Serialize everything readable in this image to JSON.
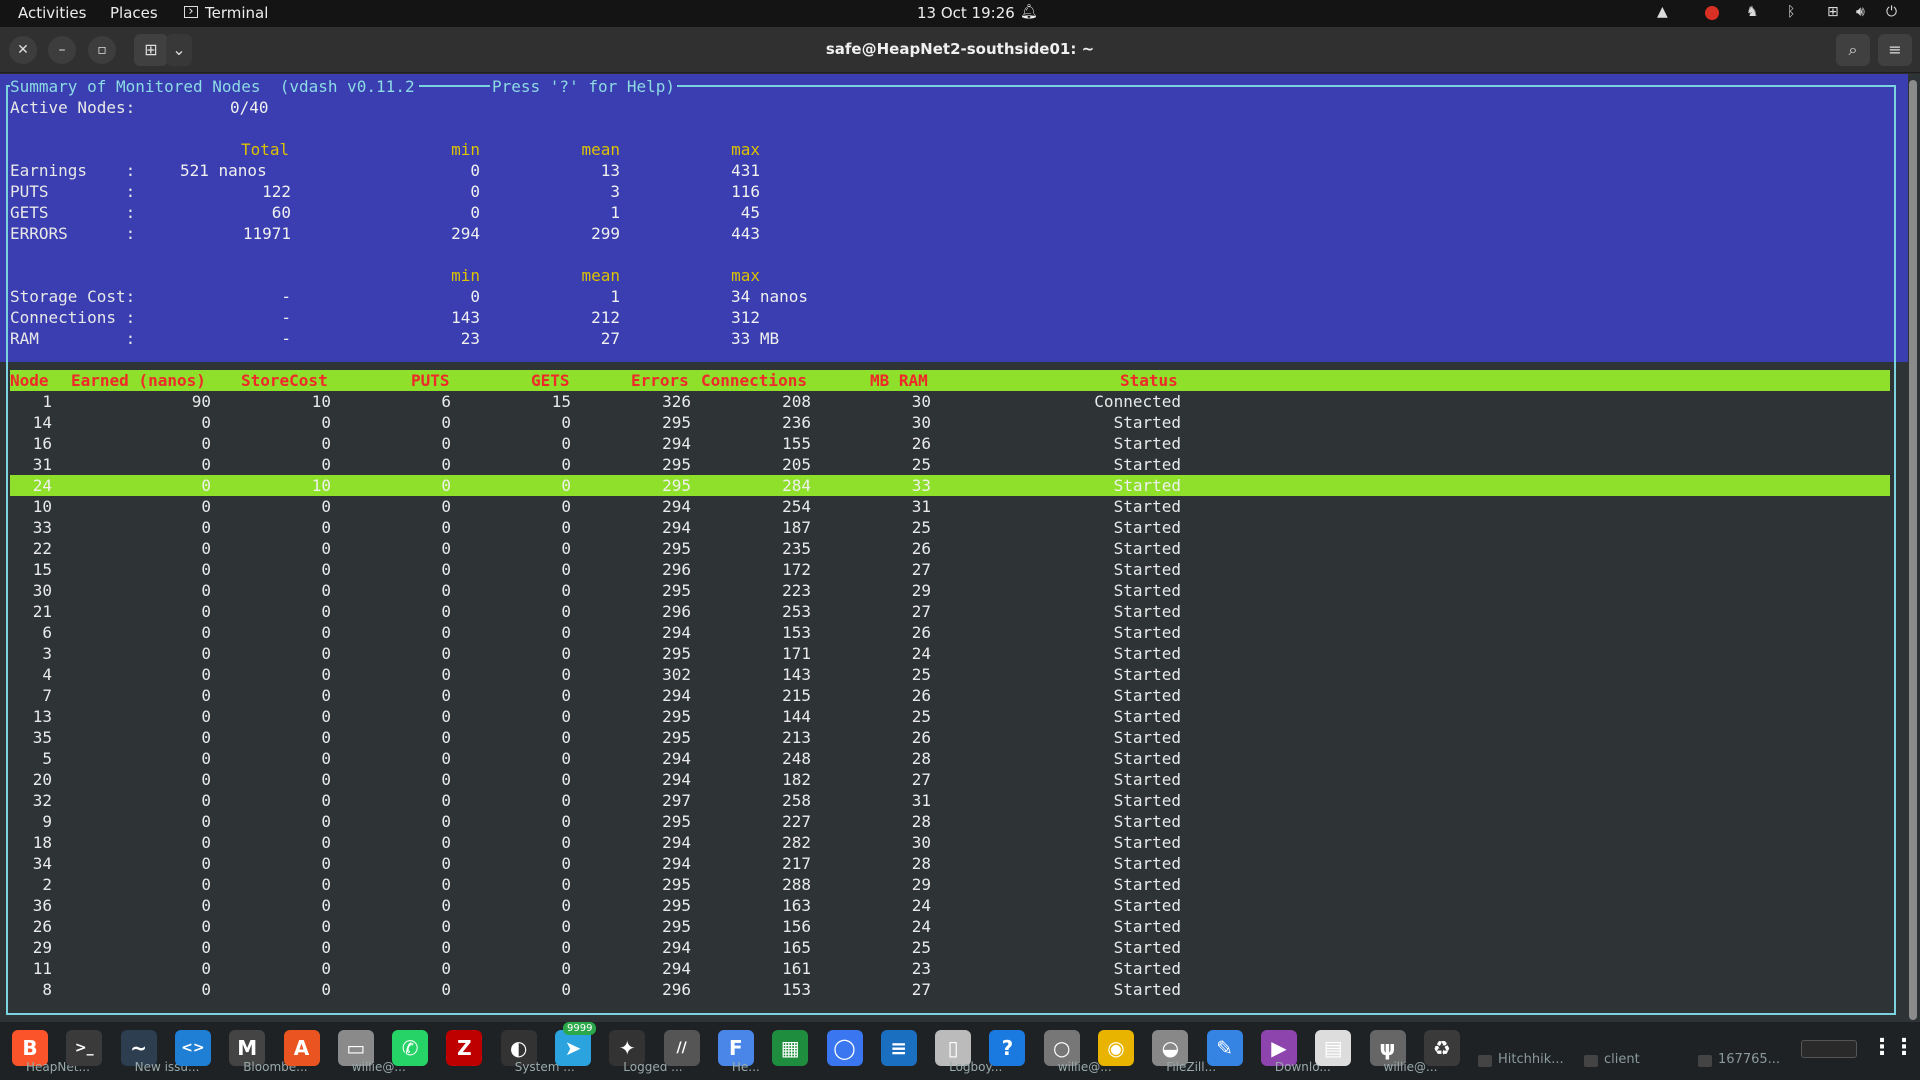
{
  "topbar": {
    "activities": "Activities",
    "places": "Places",
    "app": "Terminal",
    "clock": "13 Oct  19:26"
  },
  "window": {
    "title": "safe@HeapNet2-southside01: ~"
  },
  "summary": {
    "title": "Summary of Monitored Nodes  (vdash v0.11.2",
    "help": "Press '?' for Help)",
    "active_label": "Active Nodes:",
    "active_value": "0/40",
    "headers1": {
      "total": "Total",
      "min": "min",
      "mean": "mean",
      "max": "max"
    },
    "stats": [
      {
        "label": "Earnings    :",
        "total": "521 nanos",
        "min": "0",
        "mean": "13",
        "max": "431"
      },
      {
        "label": "PUTS        :",
        "total": "122",
        "min": "0",
        "mean": "3",
        "max": "116"
      },
      {
        "label": "GETS        :",
        "total": "60",
        "min": "0",
        "mean": "1",
        "max": "45"
      },
      {
        "label": "ERRORS      :",
        "total": "11971",
        "min": "294",
        "mean": "299",
        "max": "443"
      }
    ],
    "headers2": {
      "min": "min",
      "mean": "mean",
      "max": "max"
    },
    "stats2": [
      {
        "label": "Storage Cost:",
        "total": "-",
        "min": "0",
        "mean": "1",
        "max": "34 nanos"
      },
      {
        "label": "Connections :",
        "total": "-",
        "min": "143",
        "mean": "212",
        "max": "312"
      },
      {
        "label": "RAM         :",
        "total": "-",
        "min": "23",
        "mean": "27",
        "max": "33 MB"
      }
    ]
  },
  "table": {
    "headers": [
      "Node",
      "Earned (nanos)",
      "StoreCost",
      "PUTS",
      "GETS",
      "Errors",
      "Connections",
      "MB RAM",
      "Status"
    ],
    "selected_index": 4,
    "rows": [
      [
        "1",
        "90",
        "10",
        "6",
        "15",
        "326",
        "208",
        "30",
        "Connected"
      ],
      [
        "14",
        "0",
        "0",
        "0",
        "0",
        "295",
        "236",
        "30",
        "Started"
      ],
      [
        "16",
        "0",
        "0",
        "0",
        "0",
        "294",
        "155",
        "26",
        "Started"
      ],
      [
        "31",
        "0",
        "0",
        "0",
        "0",
        "295",
        "205",
        "25",
        "Started"
      ],
      [
        "24",
        "0",
        "10",
        "0",
        "0",
        "295",
        "284",
        "33",
        "Started"
      ],
      [
        "10",
        "0",
        "0",
        "0",
        "0",
        "294",
        "254",
        "31",
        "Started"
      ],
      [
        "33",
        "0",
        "0",
        "0",
        "0",
        "294",
        "187",
        "25",
        "Started"
      ],
      [
        "22",
        "0",
        "0",
        "0",
        "0",
        "295",
        "235",
        "26",
        "Started"
      ],
      [
        "15",
        "0",
        "0",
        "0",
        "0",
        "296",
        "172",
        "27",
        "Started"
      ],
      [
        "30",
        "0",
        "0",
        "0",
        "0",
        "295",
        "223",
        "29",
        "Started"
      ],
      [
        "21",
        "0",
        "0",
        "0",
        "0",
        "296",
        "253",
        "27",
        "Started"
      ],
      [
        "6",
        "0",
        "0",
        "0",
        "0",
        "294",
        "153",
        "26",
        "Started"
      ],
      [
        "3",
        "0",
        "0",
        "0",
        "0",
        "295",
        "171",
        "24",
        "Started"
      ],
      [
        "4",
        "0",
        "0",
        "0",
        "0",
        "302",
        "143",
        "25",
        "Started"
      ],
      [
        "7",
        "0",
        "0",
        "0",
        "0",
        "294",
        "215",
        "26",
        "Started"
      ],
      [
        "13",
        "0",
        "0",
        "0",
        "0",
        "295",
        "144",
        "25",
        "Started"
      ],
      [
        "35",
        "0",
        "0",
        "0",
        "0",
        "295",
        "213",
        "26",
        "Started"
      ],
      [
        "5",
        "0",
        "0",
        "0",
        "0",
        "294",
        "248",
        "28",
        "Started"
      ],
      [
        "20",
        "0",
        "0",
        "0",
        "0",
        "294",
        "182",
        "27",
        "Started"
      ],
      [
        "32",
        "0",
        "0",
        "0",
        "0",
        "297",
        "258",
        "31",
        "Started"
      ],
      [
        "9",
        "0",
        "0",
        "0",
        "0",
        "295",
        "227",
        "28",
        "Started"
      ],
      [
        "18",
        "0",
        "0",
        "0",
        "0",
        "294",
        "282",
        "30",
        "Started"
      ],
      [
        "34",
        "0",
        "0",
        "0",
        "0",
        "294",
        "217",
        "28",
        "Started"
      ],
      [
        "2",
        "0",
        "0",
        "0",
        "0",
        "295",
        "288",
        "29",
        "Started"
      ],
      [
        "36",
        "0",
        "0",
        "0",
        "0",
        "295",
        "163",
        "24",
        "Started"
      ],
      [
        "26",
        "0",
        "0",
        "0",
        "0",
        "295",
        "156",
        "24",
        "Started"
      ],
      [
        "29",
        "0",
        "0",
        "0",
        "0",
        "294",
        "165",
        "25",
        "Started"
      ],
      [
        "11",
        "0",
        "0",
        "0",
        "0",
        "294",
        "161",
        "23",
        "Started"
      ],
      [
        "8",
        "0",
        "0",
        "0",
        "0",
        "296",
        "153",
        "27",
        "Started"
      ]
    ]
  },
  "dock": {
    "apps": [
      {
        "icon": "brave-icon",
        "glyph": "B",
        "color": "#fb542b",
        "label": "HeapNet..."
      },
      {
        "icon": "terminal-icon",
        "glyph": ">_",
        "color": "#3a3a3a",
        "label": ""
      },
      {
        "icon": "system-monitor-icon",
        "glyph": "~",
        "color": "#2c3e50",
        "label": "New issu..."
      },
      {
        "icon": "vscode-icon",
        "glyph": "<>",
        "color": "#1f7fd4",
        "label": ""
      },
      {
        "icon": "app-icon-4",
        "glyph": "M",
        "color": "#444",
        "label": "Bloombe..."
      },
      {
        "icon": "software-center-icon",
        "glyph": "A",
        "color": "#e95420",
        "label": ""
      },
      {
        "icon": "files-icon",
        "glyph": "▭",
        "color": "#8a8a8a",
        "label": "willie@..."
      },
      {
        "icon": "whatsapp-icon",
        "glyph": "✆",
        "color": "#25d366",
        "label": ""
      },
      {
        "icon": "filezilla-icon",
        "glyph": "Z",
        "color": "#bf0000",
        "label": ""
      },
      {
        "icon": "app-icon-9",
        "glyph": "◐",
        "color": "#333",
        "label": "System ..."
      },
      {
        "icon": "telegram-icon",
        "glyph": "➤",
        "color": "#2aa3df",
        "label": ""
      },
      {
        "icon": "app-icon-11",
        "glyph": "✦",
        "color": "#333",
        "label": "Logged ..."
      },
      {
        "icon": "app-icon-12",
        "glyph": "//",
        "color": "#555",
        "label": ""
      },
      {
        "icon": "flathub-icon",
        "glyph": "F",
        "color": "#4a86e8",
        "label": "He..."
      },
      {
        "icon": "spreadsheet-icon",
        "glyph": "▦",
        "color": "#1e8e3e",
        "label": ""
      },
      {
        "icon": "signal-icon",
        "glyph": "◯",
        "color": "#3a76f0",
        "label": ""
      },
      {
        "icon": "document-icon",
        "glyph": "≡",
        "color": "#1b6fc1",
        "label": ""
      },
      {
        "icon": "usb-creator-icon",
        "glyph": "▯",
        "color": "#bbb",
        "label": "Logboy..."
      },
      {
        "icon": "help-icon",
        "glyph": "?",
        "color": "#1b7ae0",
        "label": ""
      },
      {
        "icon": "app-icon-19",
        "glyph": "○",
        "color": "#777",
        "label": "willie@..."
      },
      {
        "icon": "rhythmbox-icon",
        "glyph": "◉",
        "color": "#e8b400",
        "label": ""
      },
      {
        "icon": "app-icon-21",
        "glyph": "◒",
        "color": "#888",
        "label": "FileZill..."
      },
      {
        "icon": "text-editor-icon",
        "glyph": "✎",
        "color": "#3584e4",
        "label": ""
      },
      {
        "icon": "video-icon",
        "glyph": "▶",
        "color": "#8e44ad",
        "label": "Downlo..."
      },
      {
        "icon": "archive-icon",
        "glyph": "▤",
        "color": "#ddd",
        "label": ""
      },
      {
        "icon": "usb-icon",
        "glyph": "ψ",
        "color": "#666",
        "label": "willie@..."
      },
      {
        "icon": "trash-icon",
        "glyph": "♻",
        "color": "#3a3a3a",
        "label": ""
      }
    ],
    "tasks": [
      {
        "label": "Hitchhik..."
      },
      {
        "label": "client"
      },
      {
        "label": "167765..."
      }
    ],
    "grid_icon": "app-grid-icon",
    "badge": "9999"
  }
}
